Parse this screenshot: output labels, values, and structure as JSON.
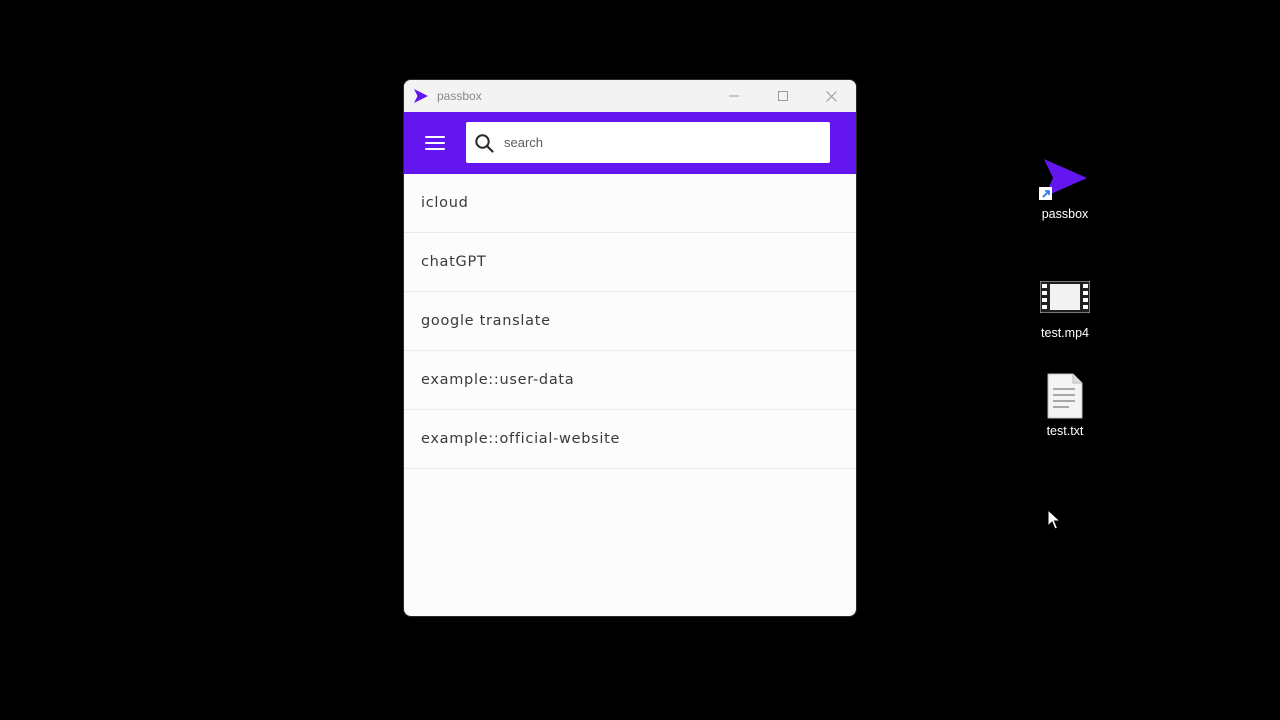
{
  "window": {
    "title": "passbox",
    "accent_color": "#6316ef"
  },
  "search": {
    "placeholder": "search",
    "value": ""
  },
  "entries": [
    {
      "label": "icloud"
    },
    {
      "label": "chatGPT"
    },
    {
      "label": "google translate"
    },
    {
      "label": "example::user-data"
    },
    {
      "label": "example::official-website"
    }
  ],
  "desktop": {
    "icons": [
      {
        "label": "passbox",
        "icon": "passbox-shortcut-icon"
      },
      {
        "label": "test.mp4",
        "icon": "video-file-icon"
      },
      {
        "label": "test.txt",
        "icon": "text-file-icon"
      }
    ]
  }
}
